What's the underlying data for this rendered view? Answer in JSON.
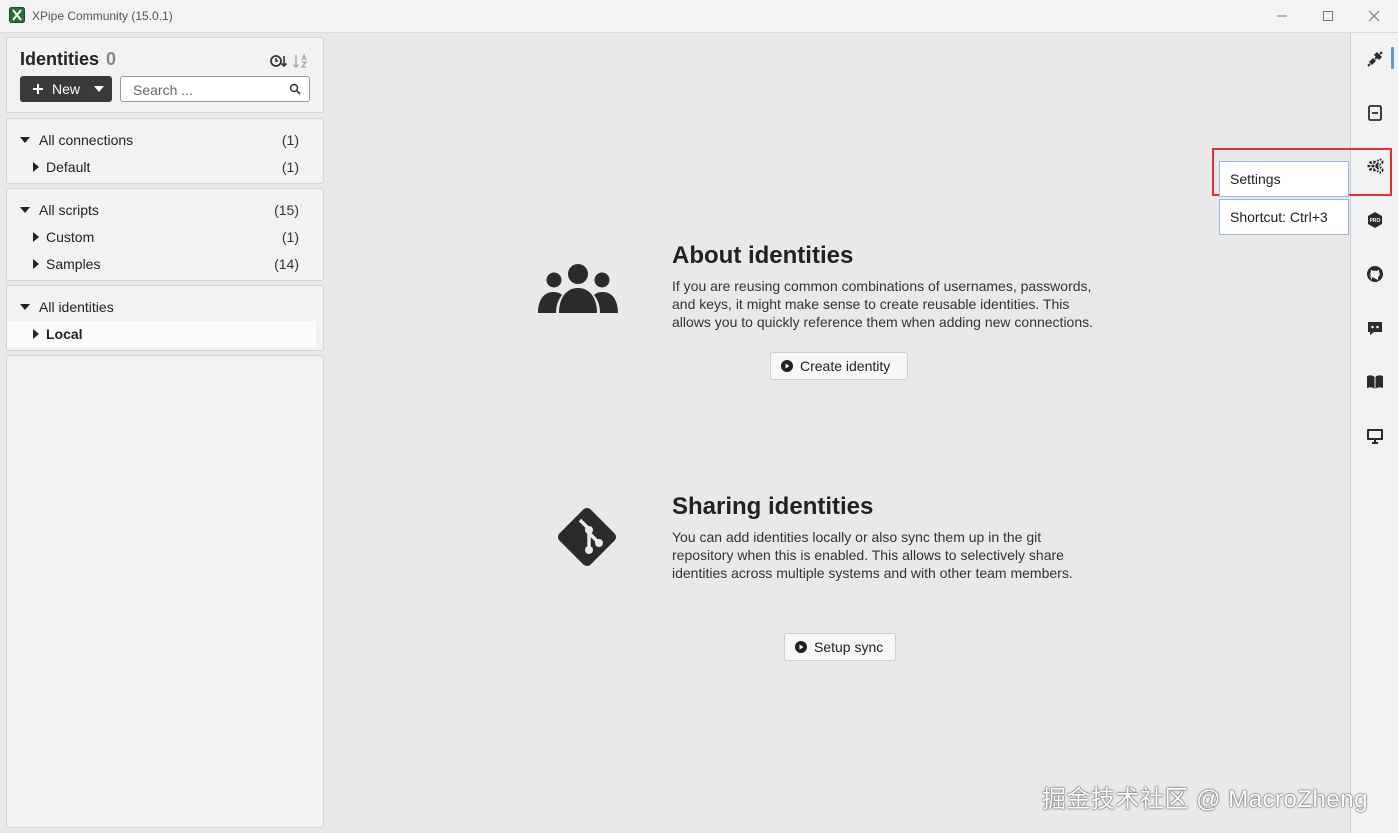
{
  "window": {
    "title": "XPipe Community (15.0.1)",
    "controls": [
      "minimize-icon",
      "maximize-icon",
      "close-icon"
    ]
  },
  "header": {
    "title": "Identities",
    "count": "0",
    "new_label": "New",
    "search_placeholder": "Search ..."
  },
  "tree": {
    "connections": {
      "label": "All connections",
      "count": "(1)",
      "children": [
        {
          "label": "Default",
          "count": "(1)"
        }
      ]
    },
    "scripts": {
      "label": "All scripts",
      "count": "(15)",
      "children": [
        {
          "label": "Custom",
          "count": "(1)"
        },
        {
          "label": "Samples",
          "count": "(14)"
        }
      ]
    },
    "identities": {
      "label": "All identities",
      "children": [
        {
          "label": "Local",
          "selected": true
        }
      ]
    }
  },
  "main": {
    "about": {
      "title": "About identities",
      "text_lines": [
        "If you are reusing common combinations of usernames, passwords,",
        "and keys, it might make sense to create reusable identities. This",
        "allows you to quickly reference them when adding new connections."
      ],
      "button": "Create identity",
      "icon": "users-icon"
    },
    "sharing": {
      "title": "Sharing identities",
      "text_lines": [
        "You can add identities locally or also sync them up in the git",
        "repository when this is enabled. This allows to selectively share",
        "identities across multiple systems and with other team members."
      ],
      "button": "Setup sync",
      "icon": "git-icon"
    }
  },
  "sidebar": {
    "items": [
      {
        "name": "connections-icon"
      },
      {
        "name": "scripts-icon"
      },
      {
        "name": "settings-icon"
      },
      {
        "name": "pro-icon",
        "text": "PRO"
      },
      {
        "name": "github-icon"
      },
      {
        "name": "discord-icon"
      },
      {
        "name": "docs-icon"
      },
      {
        "name": "monitor-icon"
      }
    ]
  },
  "tooltip": {
    "title": "Settings",
    "shortcut": "Shortcut: Ctrl+3"
  },
  "watermark": "掘金技术社区 @ MacroZheng",
  "colors": {
    "background": "#e9e9e9",
    "panel": "#f2f2f2",
    "new_button": "#3a3a3a",
    "highlight": "#e0303a",
    "accent": "#5a9bd5"
  }
}
